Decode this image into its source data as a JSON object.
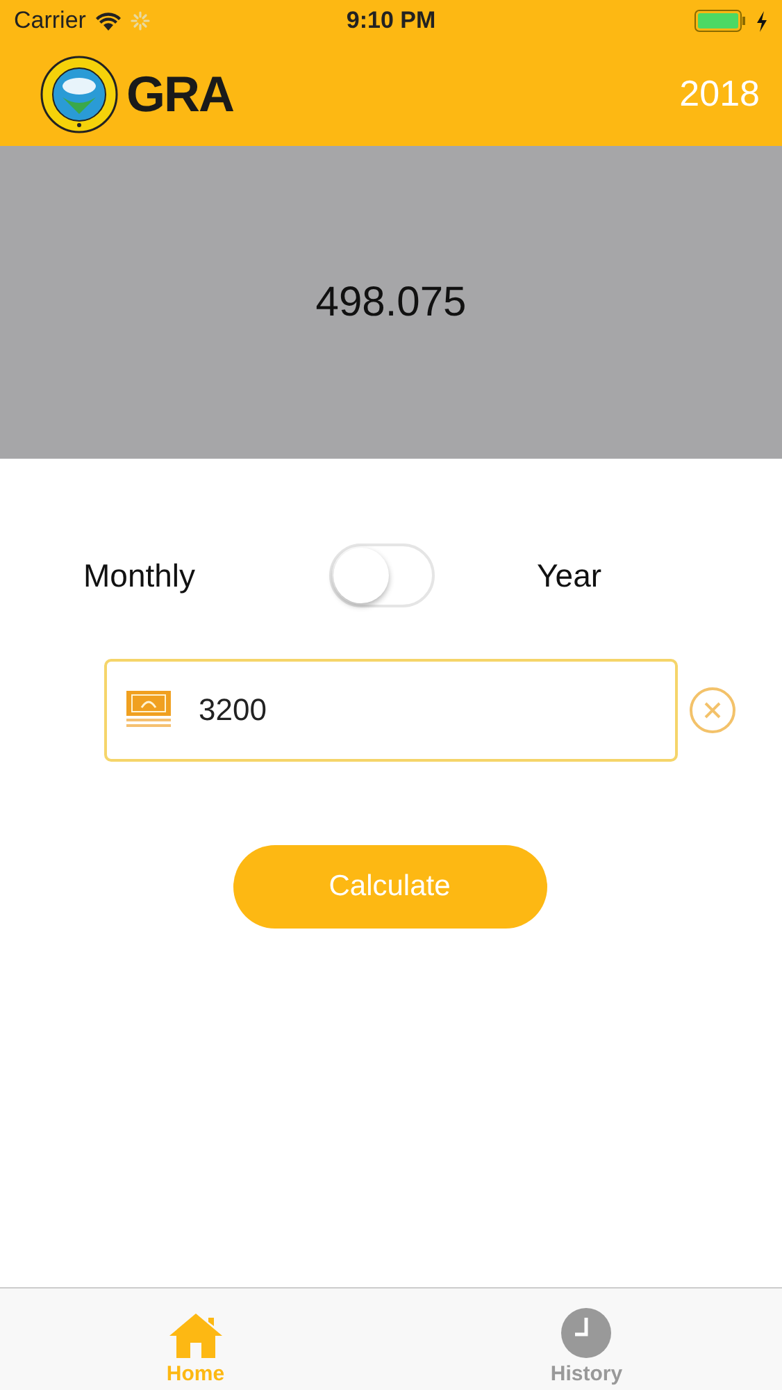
{
  "status_bar": {
    "carrier": "Carrier",
    "time": "9:10 PM",
    "charging": true
  },
  "header": {
    "logo_text": "GRA",
    "year": "2018"
  },
  "result": "498.075",
  "period": {
    "left_label": "Monthly",
    "right_label": "Year",
    "on": false
  },
  "amount_field": {
    "value": "3200"
  },
  "calculate_button": "Calculate",
  "tabs": [
    {
      "label": "Home",
      "kind": "home",
      "selected": true
    },
    {
      "label": "History",
      "kind": "history",
      "selected": false
    }
  ]
}
